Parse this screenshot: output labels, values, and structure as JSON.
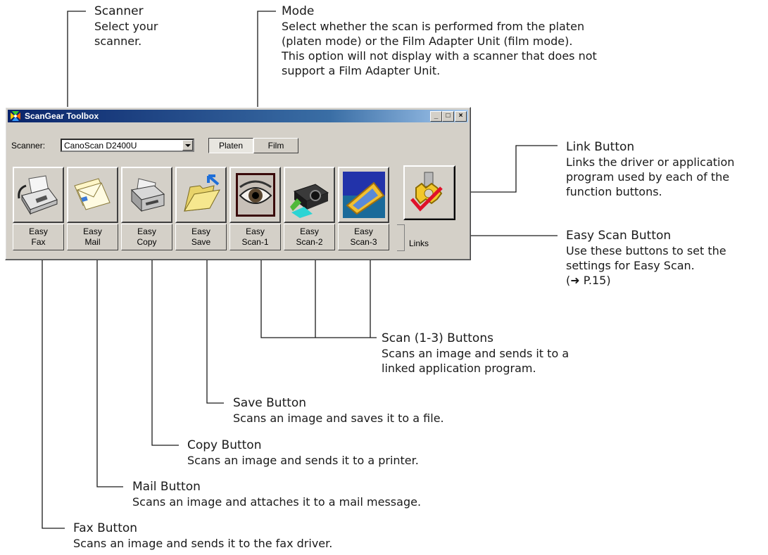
{
  "window": {
    "title": "ScanGear Toolbox",
    "controls": {
      "minimize": "_",
      "maximize": "□",
      "close": "×"
    },
    "scanner_label": "Scanner:",
    "scanner_value": "CanoScan D2400U",
    "mode_options": [
      "Platen",
      "Film"
    ],
    "mode_selected": "Platen",
    "function_buttons": [
      {
        "line1": "Easy",
        "line2": "Fax",
        "icon": "fax-icon"
      },
      {
        "line1": "Easy",
        "line2": "Mail",
        "icon": "mail-icon"
      },
      {
        "line1": "Easy",
        "line2": "Copy",
        "icon": "printer-icon"
      },
      {
        "line1": "Easy",
        "line2": "Save",
        "icon": "folder-icon"
      },
      {
        "line1": "Easy",
        "line2": "Scan-1",
        "icon": "eye-icon"
      },
      {
        "line1": "Easy",
        "line2": "Scan-2",
        "icon": "camera-icon"
      },
      {
        "line1": "Easy",
        "line2": "Scan-3",
        "icon": "photo-icon"
      }
    ],
    "links_label": "Links",
    "link_icon": "link-gear-icon"
  },
  "callouts": {
    "scanner": {
      "title": "Scanner",
      "desc": [
        "Select your",
        "scanner."
      ]
    },
    "mode": {
      "title": "Mode",
      "desc": [
        "Select whether the scan is performed from the platen",
        "(platen mode) or the Film Adapter Unit (film mode).",
        "This option will not display with a scanner that does not",
        "support a Film Adapter Unit."
      ]
    },
    "link": {
      "title": "Link Button",
      "desc": [
        "Links the driver or application",
        "program used by each of the",
        "function buttons."
      ]
    },
    "easy_scan": {
      "title": "Easy Scan Button",
      "desc": [
        "Use these buttons to set the",
        "settings for Easy Scan.",
        "(➜ P.15)"
      ]
    },
    "scan": {
      "title": "Scan (1-3) Buttons",
      "desc": [
        "Scans an image and sends it to a",
        "linked application program."
      ]
    },
    "save": {
      "title": "Save Button",
      "desc": [
        "Scans an image and saves it to a file."
      ]
    },
    "copy": {
      "title": "Copy Button",
      "desc": [
        "Scans an image and sends it to a printer."
      ]
    },
    "mail": {
      "title": "Mail Button",
      "desc": [
        "Scans an image and attaches it to a mail message."
      ]
    },
    "fax": {
      "title": "Fax Button",
      "desc": [
        "Scans an image and sends it to the fax driver."
      ]
    }
  },
  "colors": {
    "face": "#d4d0c8",
    "title_bar": "#0a246a",
    "leader": "#1a1a1a"
  }
}
